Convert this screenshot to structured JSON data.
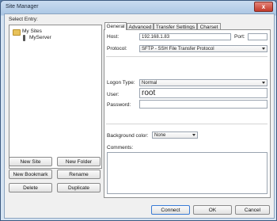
{
  "window": {
    "title": "Site Manager",
    "close_label": "x"
  },
  "left": {
    "select_entry_label": "Select Entry:",
    "tree": [
      {
        "label": "My Sites",
        "type": "folder"
      },
      {
        "label": "MyServer",
        "type": "server"
      }
    ],
    "buttons": {
      "new_site": "New Site",
      "new_folder": "New Folder",
      "new_bookmark": "New Bookmark",
      "rename": "Rename",
      "delete": "Delete",
      "duplicate": "Duplicate"
    }
  },
  "tabs": [
    {
      "label": "General",
      "active": true
    },
    {
      "label": "Advanced"
    },
    {
      "label": "Transfer Settings"
    },
    {
      "label": "Charset"
    }
  ],
  "general": {
    "host_label": "Host:",
    "host_value": "192.168.1.83",
    "port_label": "Port:",
    "port_value": "",
    "protocol_label": "Protocol:",
    "protocol_value": "SFTP - SSH File Transfer Protocol",
    "logon_type_label": "Logon Type:",
    "logon_type_value": "Normal",
    "user_label": "User:",
    "user_value": "root",
    "password_label": "Password:",
    "password_value": "",
    "background_color_label": "Background color:",
    "background_color_value": "None",
    "comments_label": "Comments:"
  },
  "footer": {
    "connect": "Connect",
    "ok": "OK",
    "cancel": "Cancel"
  }
}
